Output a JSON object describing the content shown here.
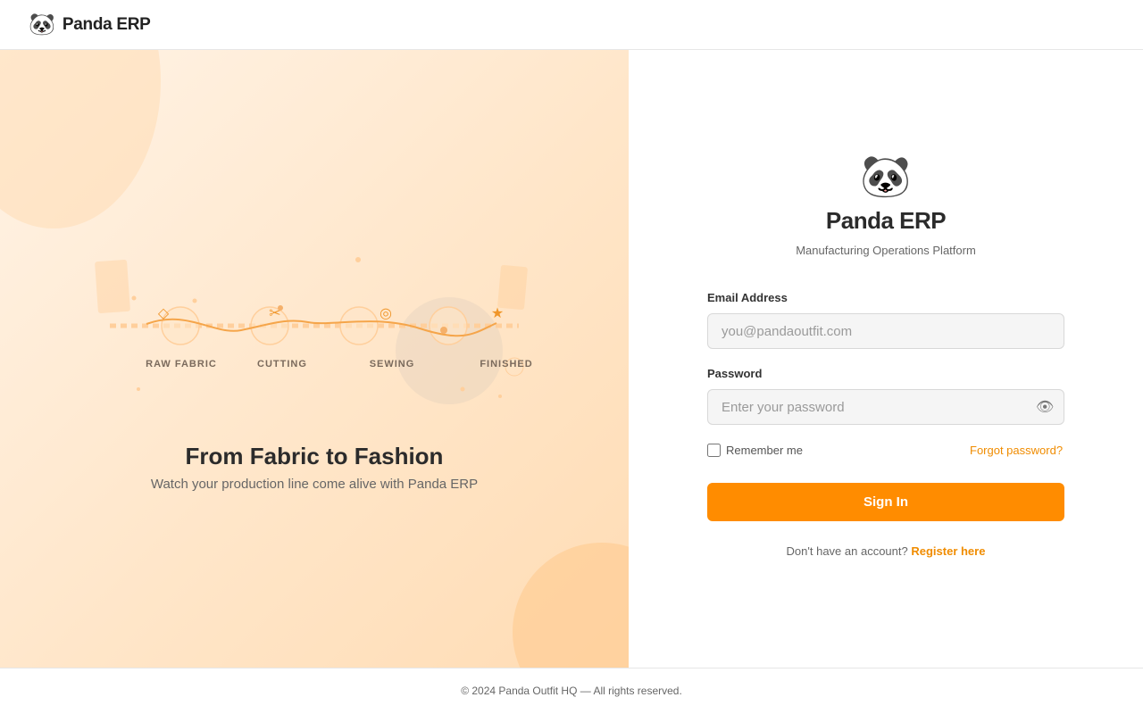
{
  "header": {
    "logo_emoji": "🐼",
    "brand": "Panda ERP"
  },
  "hero": {
    "steps": [
      {
        "label": "RAW FABRIC",
        "icon": "diamond-icon",
        "glyph": "◇"
      },
      {
        "label": "CUTTING",
        "icon": "scissors-icon",
        "glyph": "✂"
      },
      {
        "label": "SEWING",
        "icon": "target-icon",
        "glyph": "◎"
      },
      {
        "label": "FINISHED",
        "icon": "star-icon",
        "glyph": "★"
      }
    ],
    "title": "From Fabric to Fashion",
    "subtitle": "Watch your production line come alive with Panda ERP"
  },
  "login": {
    "logo_emoji": "🐼",
    "title": "Panda ERP",
    "subtitle": "Manufacturing Operations Platform",
    "email_label": "Email Address",
    "email_placeholder": "you@pandaoutfit.com",
    "email_value": "",
    "password_label": "Password",
    "password_placeholder": "Enter your password",
    "password_value": "",
    "eye_glyph": "👁",
    "remember_label": "Remember me",
    "remember_checked": false,
    "forgot_label": "Forgot password?",
    "signin_label": "Sign In",
    "register_prompt": "Don't have an account?",
    "register_link": "Register here"
  },
  "footer": {
    "text": "© 2024 Panda Outfit HQ — All rights reserved."
  },
  "colors": {
    "accent": "#ff8c00",
    "link": "#f08c00",
    "hero_bg": "#ffe6c9"
  }
}
